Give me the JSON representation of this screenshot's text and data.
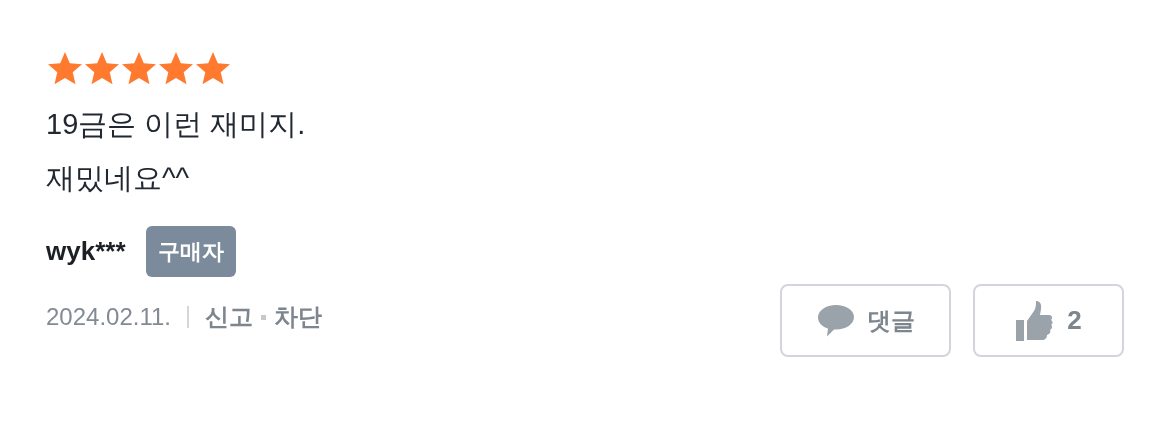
{
  "review": {
    "stars": 5,
    "lines": [
      "19금은 이런 재미지.",
      "재밌네요^^"
    ],
    "author": "wyk***",
    "badge": "구매자",
    "date": "2024.02.11.",
    "actions": [
      "신고",
      "차단"
    ],
    "comment_button": "댓글",
    "like_count": "2"
  }
}
